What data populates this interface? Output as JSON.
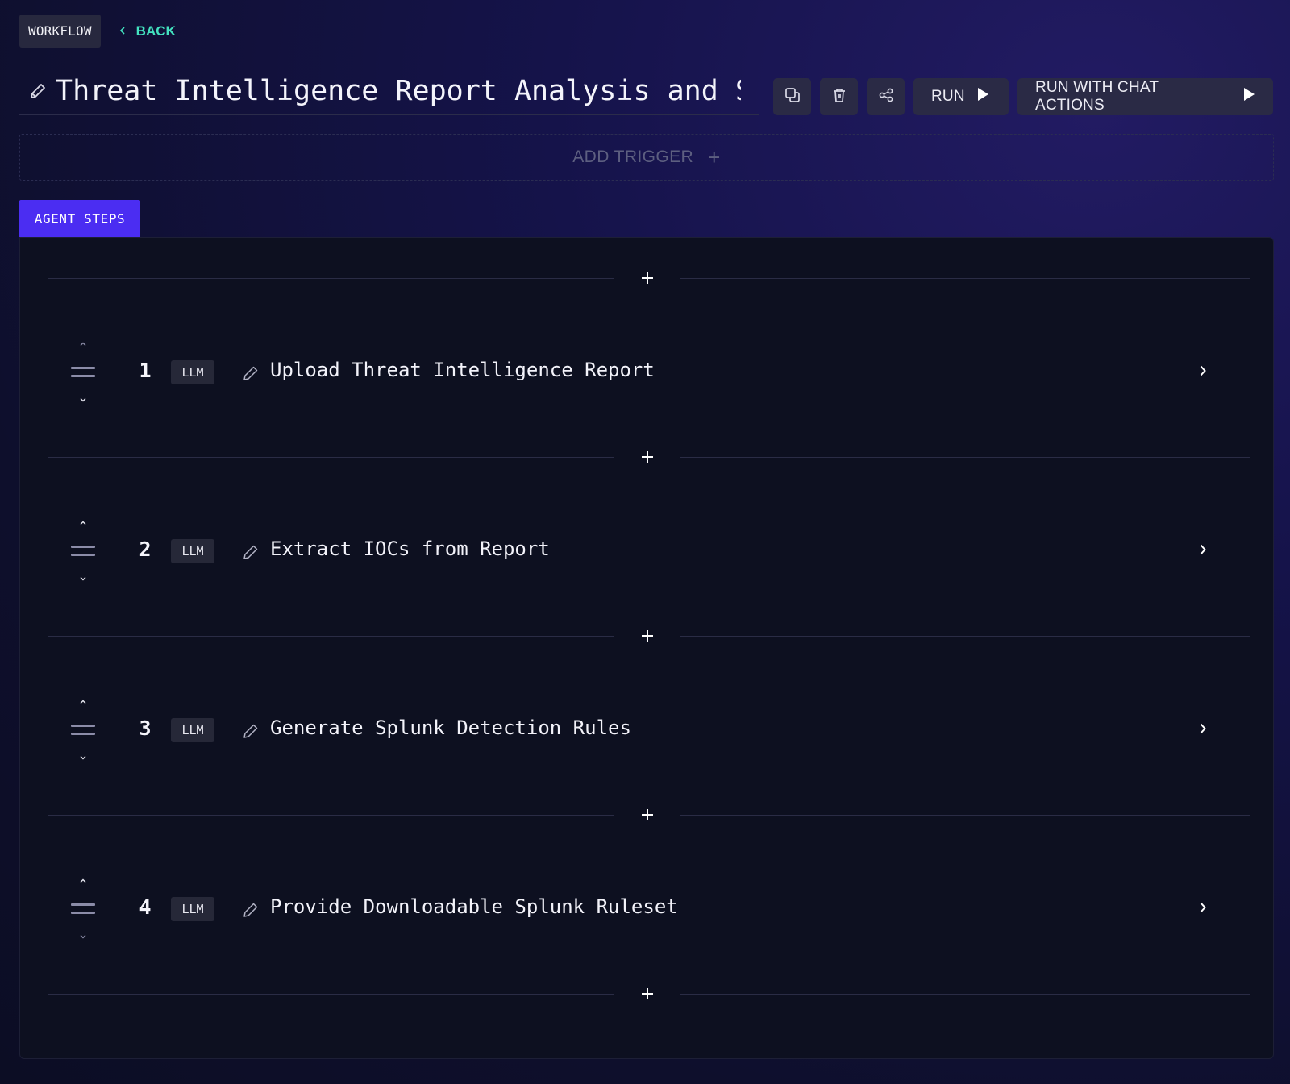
{
  "header": {
    "workflow_label": "WORKFLOW",
    "back_label": "BACK",
    "title": "Threat Intelligence Report Analysis and Splunk Rule Generation"
  },
  "actions": {
    "duplicate_icon": "copy-icon",
    "delete_icon": "trash-icon",
    "share_icon": "share-icon",
    "run_label": "RUN",
    "run_chat_label": "RUN WITH CHAT ACTIONS"
  },
  "trigger": {
    "label": "ADD TRIGGER",
    "plus": "+"
  },
  "tabs": {
    "active_label": "AGENT STEPS"
  },
  "steps": [
    {
      "number": "1",
      "type": "LLM",
      "title": "Upload Threat Intelligence Report"
    },
    {
      "number": "2",
      "type": "LLM",
      "title": "Extract IOCs from Report"
    },
    {
      "number": "3",
      "type": "LLM",
      "title": "Generate Splunk Detection Rules"
    },
    {
      "number": "4",
      "type": "LLM",
      "title": "Provide Downloadable Splunk Ruleset"
    }
  ],
  "colors": {
    "accent": "#4b2df2",
    "back_link": "#43e3c0",
    "panel_bg": "#0d1020",
    "button_bg": "#2a2a45"
  }
}
